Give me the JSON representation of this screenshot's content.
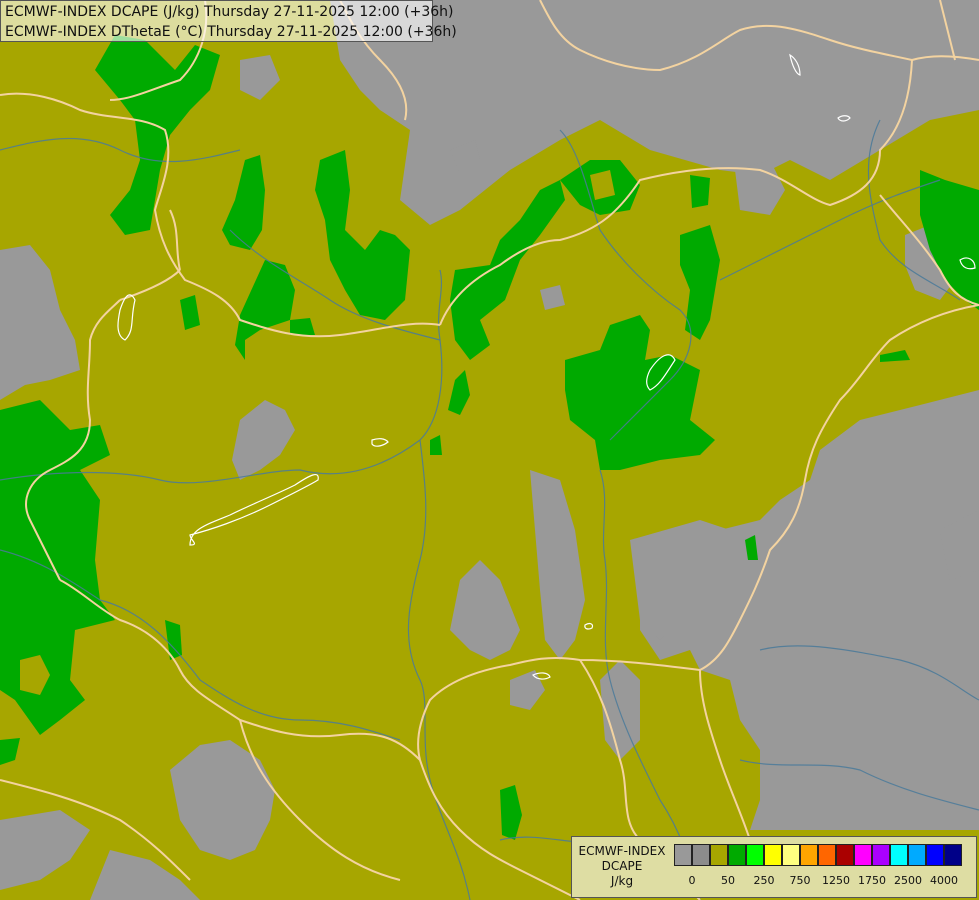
{
  "header": {
    "line1": "ECMWF-INDEX DCAPE (J/kg) Thursday 27-11-2025 12:00 (+36h)",
    "line2": "ECMWF-INDEX DThetaE (°C) Thursday 27-11-2025 12:00 (+36h)"
  },
  "legend": {
    "title_lines": [
      "ECMWF-INDEX",
      "DCAPE",
      "J/kg"
    ],
    "swatch_colors": [
      "#999999",
      "#8c8c8c",
      "#a7a600",
      "#00aa00",
      "#00ff00",
      "#ffff00",
      "#ffff80",
      "#ffa500",
      "#ff6600",
      "#aa0000",
      "#ff00ff",
      "#aa00ff",
      "#00ffff",
      "#00aaff",
      "#0000ff",
      "#000088"
    ],
    "tick_labels": [
      "0",
      "50",
      "250",
      "750",
      "1250",
      "1750",
      "2500",
      "4000"
    ]
  },
  "colors": {
    "low_dcape_olive": "#a7a600",
    "moderate_dcape_green": "#00aa00",
    "no_data_grey": "#999999",
    "borders": "#f3d3a0",
    "rivers": "#4a7a9a",
    "lakes": "#ffffff"
  }
}
